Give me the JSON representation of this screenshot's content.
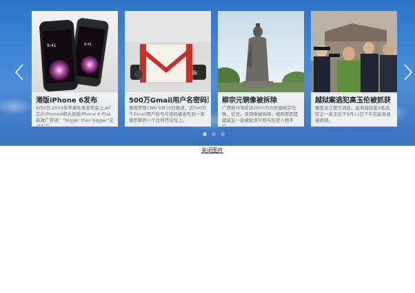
{
  "carousel": {
    "cards": [
      {
        "title": "港版iPhone 6发布",
        "desc": "9月9日,2014年苹果秋季发布会上,A7芯片iPhone6和大屏版iPhone 6 Plus新款广告词：“bigger than bigger”正式发布。",
        "image": "iphone-photo"
      },
      {
        "title": "500万Gmail用户名密码泄漏",
        "desc": "据俄罗斯CNN 9月10日报道，近500万个Gmail用户账号与密码被发布到一家俄罗斯的一个比特币论坛上。",
        "image": "gmail-logo"
      },
      {
        "title": "柳宗元铜像被拆除",
        "desc": "广西柳州市投资2000万元修建柳宗元像，近日，该铜像被拆除，据称原因是建成后一直被批评外观与历史人物不符。",
        "image": "statue-photo"
      },
      {
        "title": "越狱案逃犯高玉伦被抓获",
        "desc": "据黑龙江警方消息，延寿越狱案3名逃犯之一高玉伦于9月11日下午在延寿县被抓获。",
        "image": "arrest-photo"
      }
    ],
    "dots": [
      "1",
      "2",
      "3"
    ],
    "active_dot": 1
  },
  "more_link": "关闭图片",
  "colors": {
    "banner_blue": "#3f86d6",
    "card_bg": "#e9ecef",
    "title_text": "#222222",
    "desc_text": "#6a6f75"
  },
  "icons": {
    "prev": "chevron-left-icon",
    "next": "chevron-right-icon"
  }
}
